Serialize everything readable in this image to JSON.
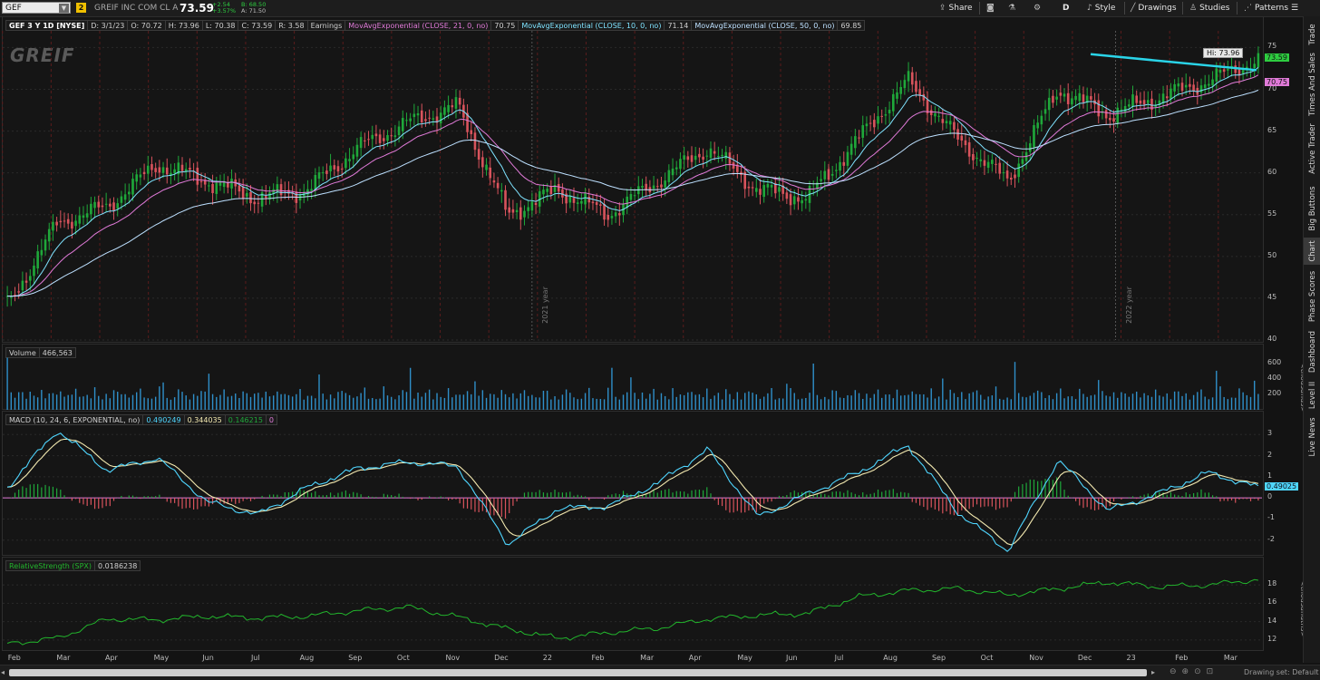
{
  "toolbar": {
    "symbol": "GEF",
    "link_badge": "2",
    "company": "GREIF INC COM CL A",
    "last": "73.59",
    "change": "+2.54",
    "change_pct": "+3.57%",
    "bid": "B: 68.50",
    "ask": "A: 71.50",
    "share": "Share",
    "frequency": "D",
    "style": "Style",
    "drawings": "Drawings",
    "studies": "Studies",
    "patterns": "Patterns"
  },
  "price_panel": {
    "title": "GEF 3 Y 1D [NYSE]",
    "date": "D: 3/1/23",
    "open": "O: 70.72",
    "high": "H: 73.96",
    "low": "L: 70.38",
    "close": "C: 73.59",
    "range": "R: 3.58",
    "earnings": "Earnings",
    "ma21_label": "MovAvgExponential (CLOSE, 21, 0, no)",
    "ma21_value": "70.75",
    "ma10_label": "MovAvgExponential (CLOSE, 10, 0, no)",
    "ma10_value": "71.14",
    "ma50_label": "MovAvgExponential (CLOSE, 50, 0, no)",
    "ma50_value": "69.85",
    "watermark": "GREIF",
    "hi_callout": "Hi: 73.96",
    "last_badge": "73.59",
    "ma_badge": "70.75",
    "y_ticks": [
      "75",
      "70",
      "65",
      "60",
      "55",
      "50",
      "45",
      "40"
    ],
    "year_markers": [
      "2021 year",
      "2022 year"
    ]
  },
  "volume_panel": {
    "title": "Volume",
    "value": "466,563",
    "y_ticks": [
      "600",
      "400",
      "200"
    ],
    "unit": "<thousands>"
  },
  "macd_panel": {
    "title": "MACD (10, 24, 6, EXPONENTIAL, no)",
    "macd": "0.490249",
    "signal": "0.344035",
    "hist": "0.146215",
    "zero": "0",
    "badge": "0.49025",
    "y_ticks": [
      "3",
      "2",
      "1",
      "0",
      "-1",
      "-2"
    ]
  },
  "rs_panel": {
    "title": "RelativeStrength (SPX)",
    "value": "0.0186238",
    "y_ticks": [
      "18",
      "16",
      "14",
      "12"
    ],
    "unit": "<thousandths>"
  },
  "x_axis": [
    "Feb",
    "Mar",
    "Apr",
    "May",
    "Jun",
    "Jul",
    "Aug",
    "Sep",
    "Oct",
    "Nov",
    "Dec",
    "22",
    "Feb",
    "Mar",
    "Apr",
    "May",
    "Jun",
    "Jul",
    "Aug",
    "Sep",
    "Oct",
    "Nov",
    "Dec",
    "23",
    "Feb",
    "Mar"
  ],
  "sidebar_tabs": [
    "Trade",
    "Times And Sales",
    "Active Trader",
    "Big Buttons",
    "Chart",
    "Phase Scores",
    "Dashboard",
    "Level II",
    "Live News"
  ],
  "status": "Drawing set: Default",
  "colors": {
    "up": "#1fa83a",
    "down": "#d8535c",
    "ma10": "#7fe3ff",
    "ma21": "#e07ad8",
    "ma50": "#bde0ff",
    "macd": "#4fd6ff",
    "signal": "#f3e9b0",
    "rs": "#22b52c",
    "trend": "#2ad4e8",
    "volume": "#2f8fc9"
  },
  "chart_data": [
    {
      "type": "candlestick",
      "title": "GEF 3 Y 1D [NYSE]",
      "x": [
        "Feb",
        "Mar",
        "Apr",
        "May",
        "Jun",
        "Jul",
        "Aug",
        "Sep",
        "Oct",
        "Nov",
        "Dec",
        "22",
        "Feb",
        "Mar",
        "Apr",
        "May",
        "Jun",
        "Jul",
        "Aug",
        "Sep",
        "Oct",
        "Nov",
        "Dec",
        "23",
        "Feb",
        "Mar"
      ],
      "close": [
        44,
        54,
        56,
        61,
        59,
        57,
        58,
        63,
        66,
        68,
        55,
        58,
        55,
        59,
        63,
        58,
        57,
        64,
        71,
        64,
        59,
        70,
        67,
        69,
        71,
        73.59
      ],
      "ylim": [
        40,
        77
      ]
    },
    {
      "type": "line",
      "title": "MACD (10, 24, 6, EXPONENTIAL, no)",
      "x": [
        "Feb",
        "Mar",
        "Apr",
        "May",
        "Jun",
        "Jul",
        "Aug",
        "Sep",
        "Oct",
        "Nov",
        "Dec",
        "22",
        "Feb",
        "Mar",
        "Apr",
        "May",
        "Jun",
        "Jul",
        "Aug",
        "Sep",
        "Oct",
        "Nov",
        "Dec",
        "23",
        "Feb",
        "Mar"
      ],
      "macd": [
        0.5,
        3.2,
        1.3,
        1.9,
        -0.2,
        -0.8,
        0.5,
        1.4,
        1.7,
        1.5,
        -2.2,
        -0.5,
        -0.4,
        0.7,
        2.3,
        -0.9,
        0.2,
        1.2,
        2.5,
        -0.7,
        -2.5,
        1.8,
        -0.6,
        0.2,
        1.2,
        0.49
      ],
      "ylim": [
        -2.7,
        3.4
      ]
    },
    {
      "type": "line",
      "title": "RelativeStrength (SPX)",
      "x": [
        "Feb",
        "Mar",
        "Apr",
        "May",
        "Jun",
        "Jul",
        "Aug",
        "Sep",
        "Oct",
        "Nov",
        "Dec",
        "22",
        "Feb",
        "Mar",
        "Apr",
        "May",
        "Jun",
        "Jul",
        "Aug",
        "Sep",
        "Oct",
        "Nov",
        "Dec",
        "23",
        "Feb",
        "Mar"
      ],
      "values": [
        11.6,
        12.2,
        14.3,
        14.2,
        14.6,
        14.4,
        14.6,
        15.2,
        15.6,
        14.5,
        13.2,
        12.2,
        12.8,
        13.3,
        14.3,
        14.7,
        14.9,
        16.7,
        17.4,
        17.6,
        16.9,
        17.6,
        18.3,
        17.8,
        18.0,
        18.6
      ],
      "ylim": [
        11,
        19.5
      ]
    }
  ]
}
